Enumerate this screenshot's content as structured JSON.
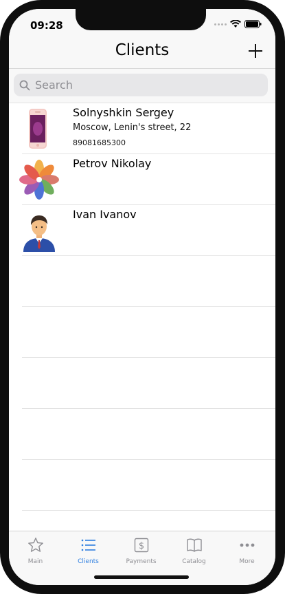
{
  "status": {
    "time": "09:28"
  },
  "nav": {
    "title": "Clients"
  },
  "search": {
    "placeholder": "Search"
  },
  "clients": [
    {
      "name": "Solnyshkin Sergey",
      "address": "Moscow, Lenin's street, 22",
      "phone": "89081685300",
      "avatar": "phone-icon"
    },
    {
      "name": "Petrov Nikolay",
      "address": "",
      "phone": "",
      "avatar": "flower-icon"
    },
    {
      "name": "Ivan Ivanov",
      "address": "",
      "phone": "",
      "avatar": "person-icon"
    }
  ],
  "tabs": [
    {
      "label": "Main",
      "icon": "star-icon",
      "active": false
    },
    {
      "label": "Clients",
      "icon": "list-icon",
      "active": true
    },
    {
      "label": "Payments",
      "icon": "dollar-icon",
      "active": false
    },
    {
      "label": "Catalog",
      "icon": "book-icon",
      "active": false
    },
    {
      "label": "More",
      "icon": "more-icon",
      "active": false
    }
  ],
  "colors": {
    "accent": "#2f7fe0",
    "inactive": "#8e8e93"
  }
}
